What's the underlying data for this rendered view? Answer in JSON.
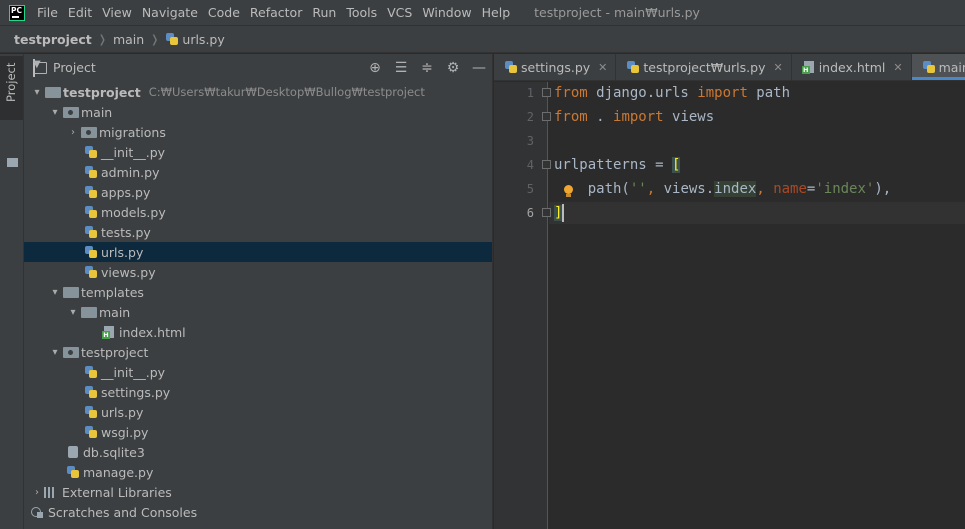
{
  "menubar": {
    "app_icon": "pycharm-icon",
    "items": [
      "File",
      "Edit",
      "View",
      "Navigate",
      "Code",
      "Refactor",
      "Run",
      "Tools",
      "VCS",
      "Window",
      "Help"
    ],
    "window_title": "testproject - main₩urls.py"
  },
  "navbar": {
    "crumbs": [
      "testproject",
      "main",
      "urls.py"
    ]
  },
  "toolstrip": {
    "project_tab": "Project"
  },
  "project_panel": {
    "title": "Project",
    "header_icons": [
      "locate-icon",
      "expand-all-icon",
      "collapse-all-icon",
      "settings-icon",
      "hide-icon"
    ],
    "tree": [
      {
        "label": "testproject",
        "path": "C:₩Users₩takur₩Desktop₩Bullog₩testproject",
        "type": "folder",
        "depth": 0,
        "expanded": true,
        "bold": true
      },
      {
        "label": "main",
        "type": "package",
        "depth": 1,
        "expanded": true
      },
      {
        "label": "migrations",
        "type": "package",
        "depth": 2,
        "expanded": false
      },
      {
        "label": "__init__.py",
        "type": "py",
        "depth": 3
      },
      {
        "label": "admin.py",
        "type": "py",
        "depth": 3
      },
      {
        "label": "apps.py",
        "type": "py",
        "depth": 3
      },
      {
        "label": "models.py",
        "type": "py",
        "depth": 3
      },
      {
        "label": "tests.py",
        "type": "py",
        "depth": 3
      },
      {
        "label": "urls.py",
        "type": "py",
        "depth": 3,
        "selected": true
      },
      {
        "label": "views.py",
        "type": "py",
        "depth": 3
      },
      {
        "label": "templates",
        "type": "folder",
        "depth": 1,
        "expanded": true
      },
      {
        "label": "main",
        "type": "folder",
        "depth": 2,
        "expanded": true
      },
      {
        "label": "index.html",
        "type": "html",
        "depth": 4
      },
      {
        "label": "testproject",
        "type": "package",
        "depth": 1,
        "expanded": true
      },
      {
        "label": "__init__.py",
        "type": "py",
        "depth": 3
      },
      {
        "label": "settings.py",
        "type": "py",
        "depth": 3
      },
      {
        "label": "urls.py",
        "type": "py",
        "depth": 3
      },
      {
        "label": "wsgi.py",
        "type": "py",
        "depth": 3
      },
      {
        "label": "db.sqlite3",
        "type": "db",
        "depth": 2
      },
      {
        "label": "manage.py",
        "type": "py",
        "depth": 2
      },
      {
        "label": "External Libraries",
        "type": "lib",
        "depth": 0,
        "expanded": false
      },
      {
        "label": "Scratches and Consoles",
        "type": "scratch",
        "depth": 0
      }
    ]
  },
  "editor_tabs": [
    {
      "label": "settings.py",
      "icon": "python-file-icon",
      "active": false
    },
    {
      "label": "testproject₩urls.py",
      "icon": "python-file-icon",
      "active": false
    },
    {
      "label": "index.html",
      "icon": "html-file-icon",
      "active": false
    },
    {
      "label": "main₩urls.py",
      "icon": "python-file-icon",
      "active": true
    }
  ],
  "editor": {
    "line_numbers": [
      "1",
      "2",
      "3",
      "4",
      "5",
      "6"
    ],
    "current_line": 6,
    "code": {
      "l1": {
        "kw1": "from",
        "mod": " django.urls ",
        "kw2": "import",
        "name": " path"
      },
      "l2": {
        "kw1": "from",
        "mod": " . ",
        "kw2": "import",
        "name": " views"
      },
      "l4": {
        "name": "urlpatterns = ",
        "bracket": "["
      },
      "l5": {
        "indent": "    ",
        "fn": "path(",
        "str1": "''",
        "comma1": ", ",
        "obj": "views.",
        "attr": "index",
        "comma2": ", ",
        "param": "name",
        "eq": "=",
        "str2": "'index'",
        "close": "),"
      },
      "l6": {
        "bracket": "]"
      }
    }
  }
}
